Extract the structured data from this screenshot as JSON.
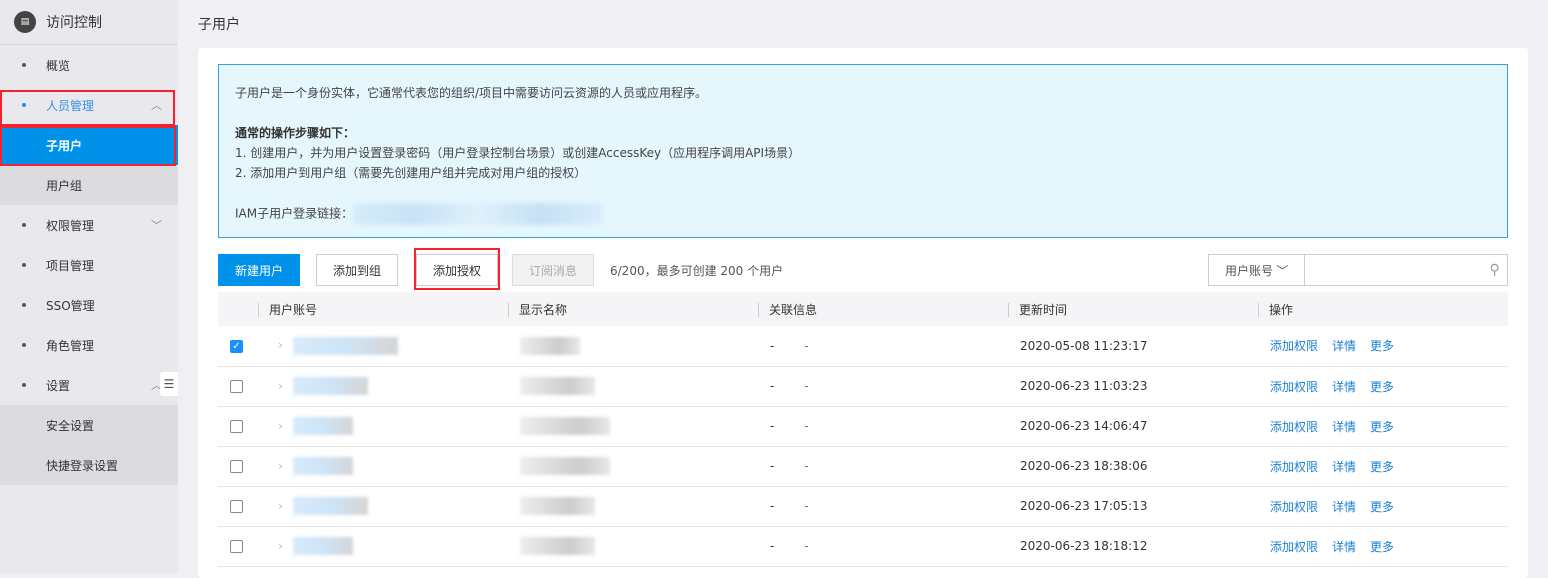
{
  "sidebar": {
    "title": "访问控制",
    "items": [
      {
        "label": "概览"
      },
      {
        "label": "人员管理"
      },
      {
        "label": "子用户"
      },
      {
        "label": "用户组"
      },
      {
        "label": "权限管理"
      },
      {
        "label": "项目管理"
      },
      {
        "label": "SSO管理"
      },
      {
        "label": "角色管理"
      },
      {
        "label": "设置"
      },
      {
        "label": "安全设置"
      },
      {
        "label": "快捷登录设置"
      }
    ]
  },
  "page": {
    "title": "子用户"
  },
  "info": {
    "line1": "子用户是一个身份实体，它通常代表您的组织/项目中需要访问云资源的人员或应用程序。",
    "steps_title": "通常的操作步骤如下：",
    "step1": "1. 创建用户，并为用户设置登录密码（用户登录控制台场景）或创建AccessKey（应用程序调用API场景）",
    "step2": "2. 添加用户到用户组（需要先创建用户组并完成对用户组的授权）",
    "iam_label": "IAM子用户登录链接："
  },
  "toolbar": {
    "new_user": "新建用户",
    "add_to_group": "添加到组",
    "add_auth": "添加授权",
    "subscribe": "订阅消息",
    "count": "6/200，最多可创建 200 个用户",
    "search_type": "用户账号",
    "search_placeholder": ""
  },
  "table": {
    "headers": [
      "用户账号",
      "显示名称",
      "关联信息",
      "更新时间",
      "操作"
    ],
    "rows": [
      {
        "checked": true,
        "rel1": "-",
        "rel2": "-",
        "time": "2020-05-08 11:23:17"
      },
      {
        "checked": false,
        "rel1": "-",
        "rel2": "-",
        "time": "2020-06-23 11:03:23"
      },
      {
        "checked": false,
        "rel1": "-",
        "rel2": "-",
        "time": "2020-06-23 14:06:47"
      },
      {
        "checked": false,
        "rel1": "-",
        "rel2": "-",
        "time": "2020-06-23 18:38:06"
      },
      {
        "checked": false,
        "rel1": "-",
        "rel2": "-",
        "time": "2020-06-23 17:05:13"
      },
      {
        "checked": false,
        "rel1": "-",
        "rel2": "-",
        "time": "2020-06-23 18:18:12"
      }
    ],
    "actions": {
      "add_perm": "添加权限",
      "detail": "详情",
      "more": "更多"
    }
  }
}
